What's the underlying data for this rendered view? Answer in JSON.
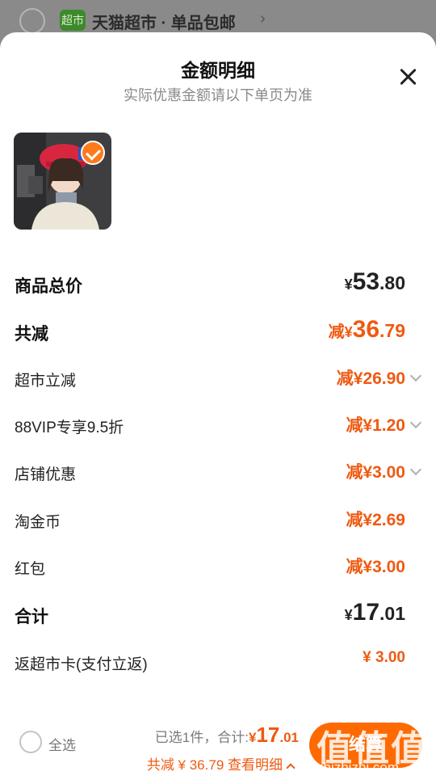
{
  "background_store": {
    "badge": "超市",
    "name": "天猫超市 · 单品包邮",
    "arrow": "›"
  },
  "sheet": {
    "title": "金额明细",
    "subtitle": "实际优惠金额请以下单页为准"
  },
  "rows": [
    {
      "label": "商品总价",
      "yen": "¥",
      "int": "53",
      "dec": ".80"
    },
    {
      "label": "共减",
      "prefix": "减",
      "yen": "¥",
      "int": "36",
      "dec": ".79"
    },
    {
      "label": "超市立减",
      "value": "减¥26.90"
    },
    {
      "label": "88VIP专享9.5折",
      "value": "减¥1.20"
    },
    {
      "label": "店铺优惠",
      "value": "减¥3.00"
    },
    {
      "label": "淘金币",
      "value": "减¥2.69"
    },
    {
      "label": "红包",
      "value": "减¥3.00"
    },
    {
      "label": "合计",
      "yen": "¥",
      "int": "17",
      "dec": ".01"
    },
    {
      "label": "返超市卡(支付立返)",
      "value": "¥ 3.00"
    }
  ],
  "footer": {
    "select_all": "全选",
    "selected_text": "已选1件，合计:",
    "total_yen": "¥",
    "total_int": "17",
    "total_dec": ".01",
    "detail": "共减 ¥ 36.79 查看明细",
    "settle_button": "结算",
    "watermark": "值值值",
    "watermark_url": "zhizhizhi.com"
  },
  "colors": {
    "accent": "#ef5a12",
    "button": "#ff6a00",
    "tmall_green": "#3d8a2a"
  }
}
